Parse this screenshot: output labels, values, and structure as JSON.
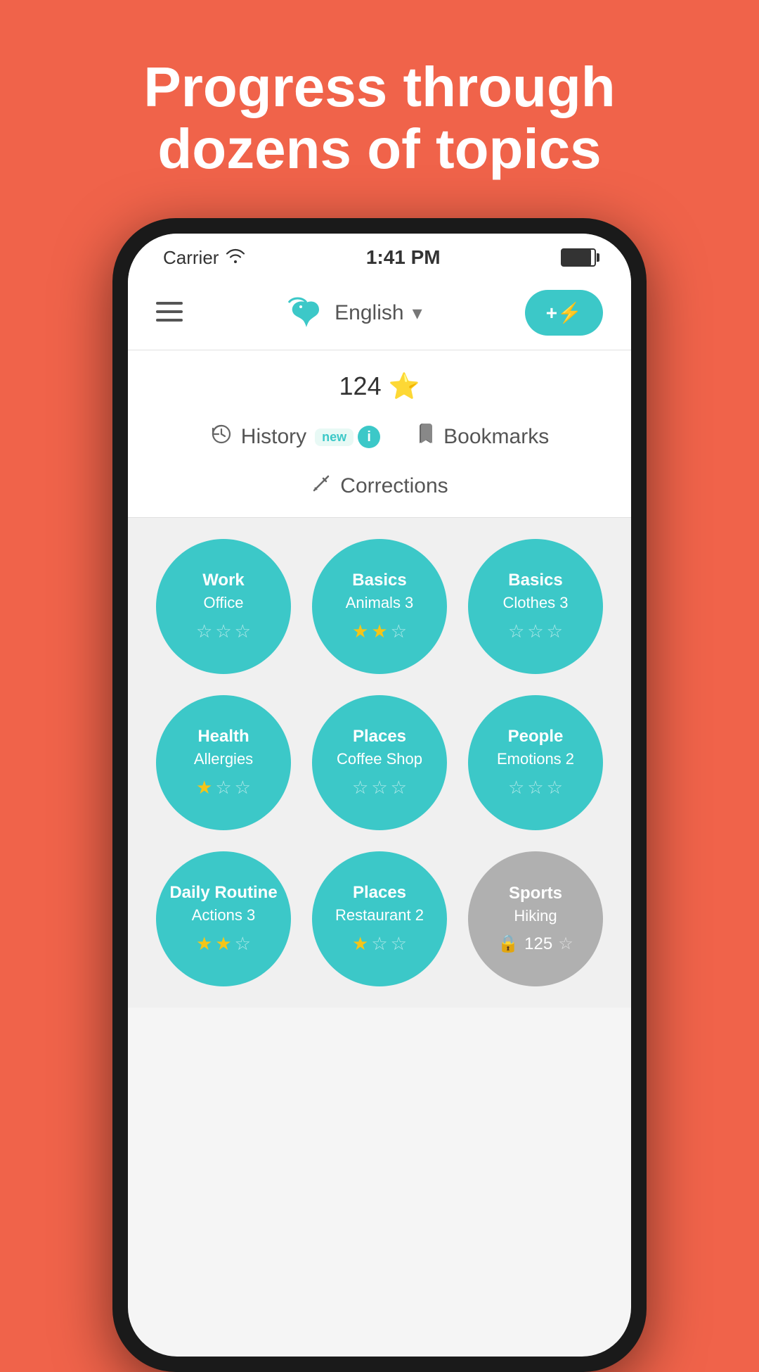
{
  "hero": {
    "title": "Progress through dozens of topics"
  },
  "status_bar": {
    "carrier": "Carrier",
    "time": "1:41 PM"
  },
  "header": {
    "language": "English",
    "add_button_label": "+⚡"
  },
  "stars_count": "124",
  "nav": {
    "history_label": "History",
    "bookmarks_label": "Bookmarks",
    "corrections_label": "Corrections",
    "new_badge": "new"
  },
  "topics": [
    {
      "category": "Work",
      "name": "Office",
      "stars": 0,
      "locked": false
    },
    {
      "category": "Basics",
      "name": "Animals 3",
      "stars": 2,
      "locked": false
    },
    {
      "category": "Basics",
      "name": "Clothes 3",
      "stars": 0,
      "locked": false
    },
    {
      "category": "Health",
      "name": "Allergies",
      "stars": 1,
      "locked": false
    },
    {
      "category": "Places",
      "name": "Coffee Shop",
      "stars": 0,
      "locked": false
    },
    {
      "category": "People",
      "name": "Emotions 2",
      "stars": 0,
      "locked": false
    },
    {
      "category": "Daily Routine",
      "name": "Actions 3",
      "stars": 2,
      "locked": false
    },
    {
      "category": "Places",
      "name": "Restaurant 2",
      "stars": 1,
      "locked": false
    },
    {
      "category": "Sports",
      "name": "Hiking",
      "stars": 0,
      "locked": true,
      "lock_score": "125"
    }
  ]
}
